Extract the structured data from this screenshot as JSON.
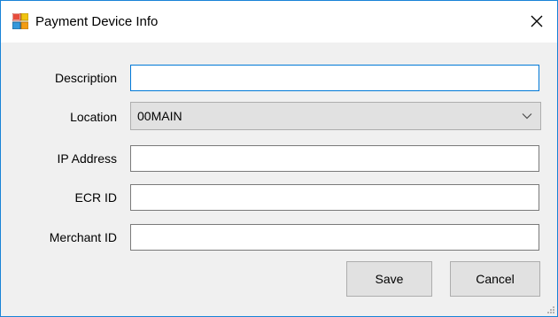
{
  "window": {
    "title": "Payment Device Info",
    "accent_color": "#1883d7",
    "icon": "app-window-icon",
    "close_glyph": "✕"
  },
  "form": {
    "description": {
      "label": "Description",
      "value": ""
    },
    "location": {
      "label": "Location",
      "value": "00MAIN"
    },
    "ip_address": {
      "label": "IP Address",
      "value": ""
    },
    "ecr_id": {
      "label": "ECR ID",
      "value": ""
    },
    "merchant_id": {
      "label": "Merchant ID",
      "value": ""
    }
  },
  "buttons": {
    "save_label": "Save",
    "cancel_label": "Cancel"
  }
}
